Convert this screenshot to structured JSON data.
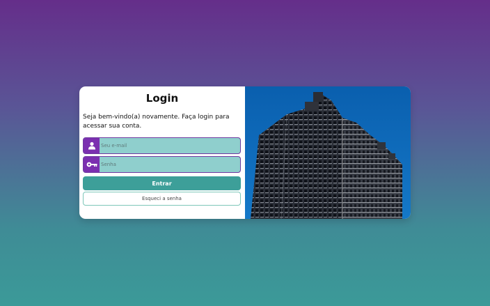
{
  "login": {
    "title": "Login",
    "welcome": "Seja bem-vindo(a) novamente. Faça login para acessar sua conta.",
    "email": {
      "placeholder": "Seu e-mail",
      "value": "",
      "icon": "user-icon"
    },
    "password": {
      "placeholder": "Senha",
      "value": "",
      "icon": "key-icon"
    },
    "submit_label": "Entrar",
    "forgot_label": "Esqueci a senha"
  },
  "photo": {
    "subject": "building-photo"
  },
  "colors": {
    "accent_purple": "#7b2fb0",
    "field_teal": "#8fcfcd",
    "button_teal": "#3d9f99"
  }
}
